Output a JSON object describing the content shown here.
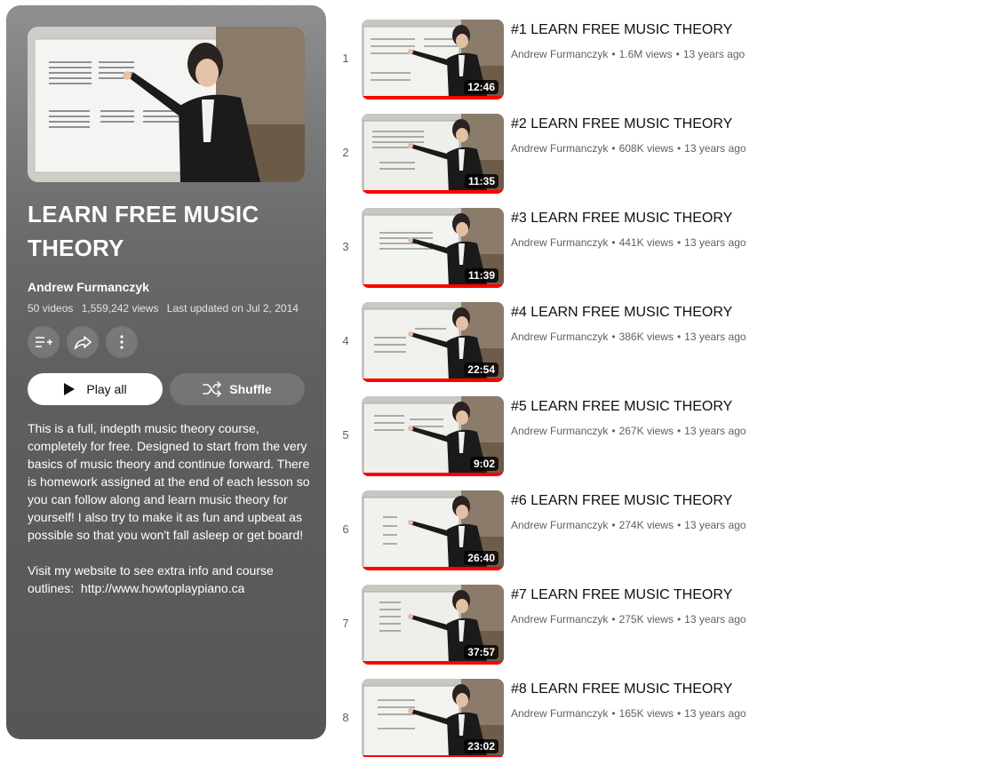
{
  "playlist": {
    "title": "LEARN FREE MUSIC THEORY",
    "owner": "Andrew Furmanczyk",
    "video_count": "50 videos",
    "views": "1,559,242 views",
    "last_updated": "Last updated on Jul 2, 2014",
    "actions": {
      "save_icon": "playlist-add-icon",
      "share_icon": "share-icon",
      "more_icon": "more-vert-icon"
    },
    "play_all_label": "Play all",
    "shuffle_label": "Shuffle",
    "description": [
      "This is a full, indepth music theory course, completely for free. Designed to start from the very basics of music theory and continue forward. There is homework assigned at the end of each lesson so you can follow along and learn music theory for yourself! I also try to make it as fun and upbeat as possible so that you won't fall asleep or get board!",
      "Visit my website to see extra info and course outlines:  http://www.howtoplaypiano.ca"
    ]
  },
  "videos": [
    {
      "index": "1",
      "title": "#1 LEARN FREE MUSIC THEORY",
      "channel": "Andrew Furmanczyk",
      "views": "1.6M views",
      "age": "13 years ago",
      "duration": "12:46",
      "watched": 1.0
    },
    {
      "index": "2",
      "title": "#2 LEARN FREE MUSIC THEORY",
      "channel": "Andrew Furmanczyk",
      "views": "608K views",
      "age": "13 years ago",
      "duration": "11:35",
      "watched": 1.0
    },
    {
      "index": "3",
      "title": "#3 LEARN FREE MUSIC THEORY",
      "channel": "Andrew Furmanczyk",
      "views": "441K views",
      "age": "13 years ago",
      "duration": "11:39",
      "watched": 1.0
    },
    {
      "index": "4",
      "title": "#4 LEARN FREE MUSIC THEORY",
      "channel": "Andrew Furmanczyk",
      "views": "386K views",
      "age": "13 years ago",
      "duration": "22:54",
      "watched": 1.0
    },
    {
      "index": "5",
      "title": "#5 LEARN FREE MUSIC THEORY",
      "channel": "Andrew Furmanczyk",
      "views": "267K views",
      "age": "13 years ago",
      "duration": "9:02",
      "watched": 1.0
    },
    {
      "index": "6",
      "title": "#6 LEARN FREE MUSIC THEORY",
      "channel": "Andrew Furmanczyk",
      "views": "274K views",
      "age": "13 years ago",
      "duration": "26:40",
      "watched": 1.0
    },
    {
      "index": "7",
      "title": "#7 LEARN FREE MUSIC THEORY",
      "channel": "Andrew Furmanczyk",
      "views": "275K views",
      "age": "13 years ago",
      "duration": "37:57",
      "watched": 1.0
    },
    {
      "index": "8",
      "title": "#8 LEARN FREE MUSIC THEORY",
      "channel": "Andrew Furmanczyk",
      "views": "165K views",
      "age": "13 years ago",
      "duration": "23:02",
      "watched": 1.0
    }
  ],
  "colors": {
    "progress": "#ff0000",
    "text_primary": "#0f0f0f",
    "text_secondary": "#606060"
  }
}
